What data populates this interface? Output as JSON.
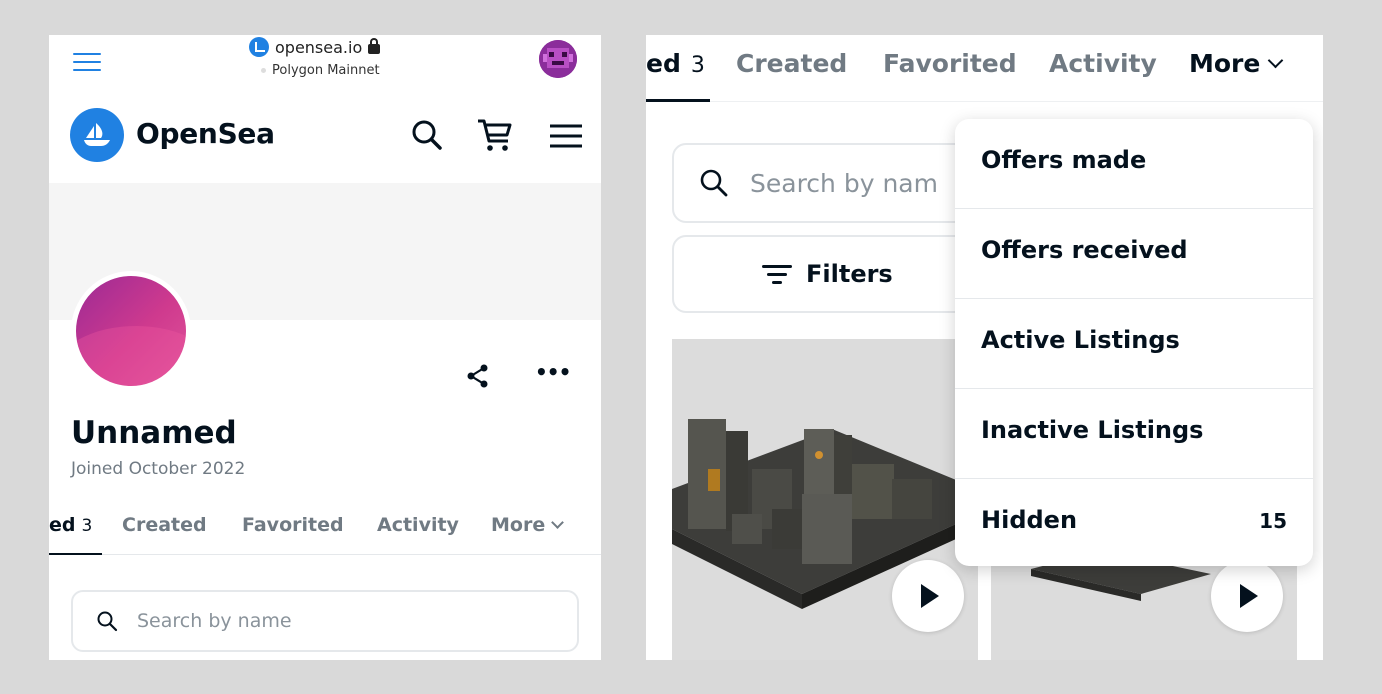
{
  "left": {
    "browser": {
      "url": "opensea.io",
      "network": "Polygon Mainnet"
    },
    "header": {
      "brand": "OpenSea"
    },
    "profile": {
      "name": "Unnamed",
      "joined": "Joined October 2022"
    },
    "tabs": [
      {
        "label": "ed",
        "count": "3"
      },
      {
        "label": "Created"
      },
      {
        "label": "Favorited"
      },
      {
        "label": "Activity"
      },
      {
        "label": "More"
      }
    ],
    "search": {
      "placeholder": "Search by name"
    }
  },
  "right": {
    "tabs": [
      {
        "label": "ed",
        "count": "3"
      },
      {
        "label": "Created"
      },
      {
        "label": "Favorited"
      },
      {
        "label": "Activity"
      },
      {
        "label": "More"
      }
    ],
    "search": {
      "placeholder": "Search by nam"
    },
    "filters_label": "Filters",
    "dropdown": [
      {
        "label": "Offers made"
      },
      {
        "label": "Offers received"
      },
      {
        "label": "Active Listings"
      },
      {
        "label": "Inactive Listings"
      },
      {
        "label": "Hidden",
        "count": "15"
      }
    ]
  },
  "colors": {
    "brand_blue": "#2081e2",
    "text_primary": "#04111d",
    "text_secondary": "#707a83",
    "page_background": "#d9d9d9"
  },
  "icons": [
    "menu-icon",
    "site-icon",
    "lock-icon",
    "avatar",
    "opensea-logo",
    "search-icon",
    "cart-icon",
    "share-icon",
    "more-icon",
    "chevron-down-icon",
    "filter-icon",
    "play-icon"
  ]
}
